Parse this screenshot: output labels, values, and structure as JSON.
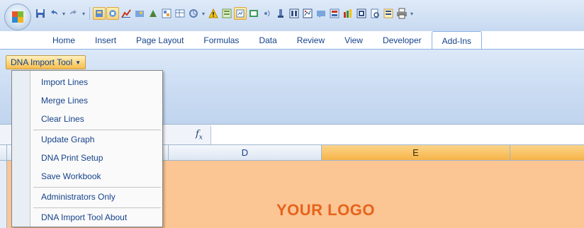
{
  "quick_access": {
    "icons": [
      "save-icon",
      "undo-icon",
      "redo-icon",
      "tool-1-icon",
      "tool-2-icon",
      "chart-icon",
      "tool-3-icon",
      "tool-4-icon",
      "tool-5-icon",
      "tool-6-icon",
      "tool-7-icon",
      "warning-icon",
      "tool-8-icon",
      "tool-9-icon",
      "tool-10-icon",
      "tool-11-icon",
      "tool-12-icon",
      "tool-13-icon",
      "tool-14-icon",
      "tool-15-icon",
      "tool-16-icon",
      "tool-17-icon",
      "tool-18-icon",
      "print-preview-icon",
      "tool-19-icon",
      "printer-icon",
      "customize-icon"
    ]
  },
  "tabs": {
    "home": "Home",
    "insert": "Insert",
    "page_layout": "Page Layout",
    "formulas": "Formulas",
    "data": "Data",
    "review": "Review",
    "view": "View",
    "developer": "Developer",
    "add_ins": "Add-Ins"
  },
  "ribbon": {
    "dna_tool_label": "DNA Import Tool"
  },
  "formula_bar": {
    "fx_label": "fx"
  },
  "columns": {
    "d": "D",
    "e": "E"
  },
  "sheet": {
    "logo_text": "YOUR LOGO"
  },
  "menu": {
    "import_lines": "Import Lines",
    "merge_lines": "Merge Lines",
    "clear_lines": "Clear Lines",
    "update_graph": "Update Graph",
    "dna_print_setup": "DNA Print Setup",
    "save_workbook": "Save Workbook",
    "administrators_only": "Administrators Only",
    "about": "DNA Import Tool About"
  },
  "colors": {
    "accent_orange": "#e7631c",
    "sheet_background": "#fbc594",
    "ribbon_blue": "#c9dbf2",
    "text_blue": "#15428b"
  }
}
